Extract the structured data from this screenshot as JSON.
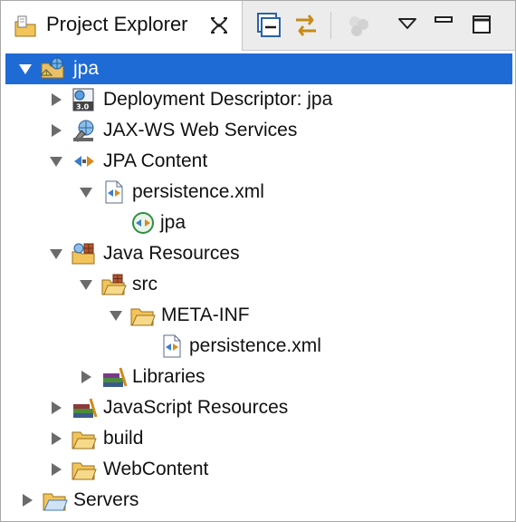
{
  "view": {
    "title": "Project Explorer",
    "tab_icon": "project-explorer-icon",
    "close_icon": "close-icon",
    "toolbar": [
      {
        "icon": "collapse-all-icon"
      },
      {
        "icon": "link-with-editor-icon"
      },
      {
        "icon": "filters-icon"
      },
      {
        "icon": "view-menu-icon"
      },
      {
        "icon": "minimize-icon"
      },
      {
        "icon": "maximize-icon"
      }
    ]
  },
  "tree": [
    {
      "label": "jpa",
      "icon": "web-project-icon",
      "state": "expanded",
      "selected": true
    },
    {
      "label": "Deployment Descriptor: jpa",
      "icon": "deployment-descriptor-icon",
      "state": "collapsed"
    },
    {
      "label": "JAX-WS Web Services",
      "icon": "web-services-icon",
      "state": "collapsed"
    },
    {
      "label": "JPA Content",
      "icon": "jpa-content-icon",
      "state": "expanded"
    },
    {
      "label": "persistence.xml",
      "icon": "xml-file-icon",
      "state": "expanded"
    },
    {
      "label": "jpa",
      "icon": "persistence-unit-icon",
      "state": "leaf"
    },
    {
      "label": "Java Resources",
      "icon": "java-resources-icon",
      "state": "expanded"
    },
    {
      "label": "src",
      "icon": "source-folder-icon",
      "state": "expanded"
    },
    {
      "label": "META-INF",
      "icon": "folder-icon",
      "state": "expanded"
    },
    {
      "label": "persistence.xml",
      "icon": "xml-file-icon",
      "state": "leaf"
    },
    {
      "label": "Libraries",
      "icon": "libraries-icon",
      "state": "collapsed"
    },
    {
      "label": "JavaScript Resources",
      "icon": "javascript-resources-icon",
      "state": "collapsed"
    },
    {
      "label": "build",
      "icon": "folder-icon",
      "state": "collapsed"
    },
    {
      "label": "WebContent",
      "icon": "folder-icon",
      "state": "collapsed"
    },
    {
      "label": "Servers",
      "icon": "servers-folder-icon",
      "state": "collapsed"
    }
  ],
  "colors": {
    "selection": "#1f6bd6",
    "folder": "#f2c45a",
    "twistie": "#6b6b6b"
  }
}
